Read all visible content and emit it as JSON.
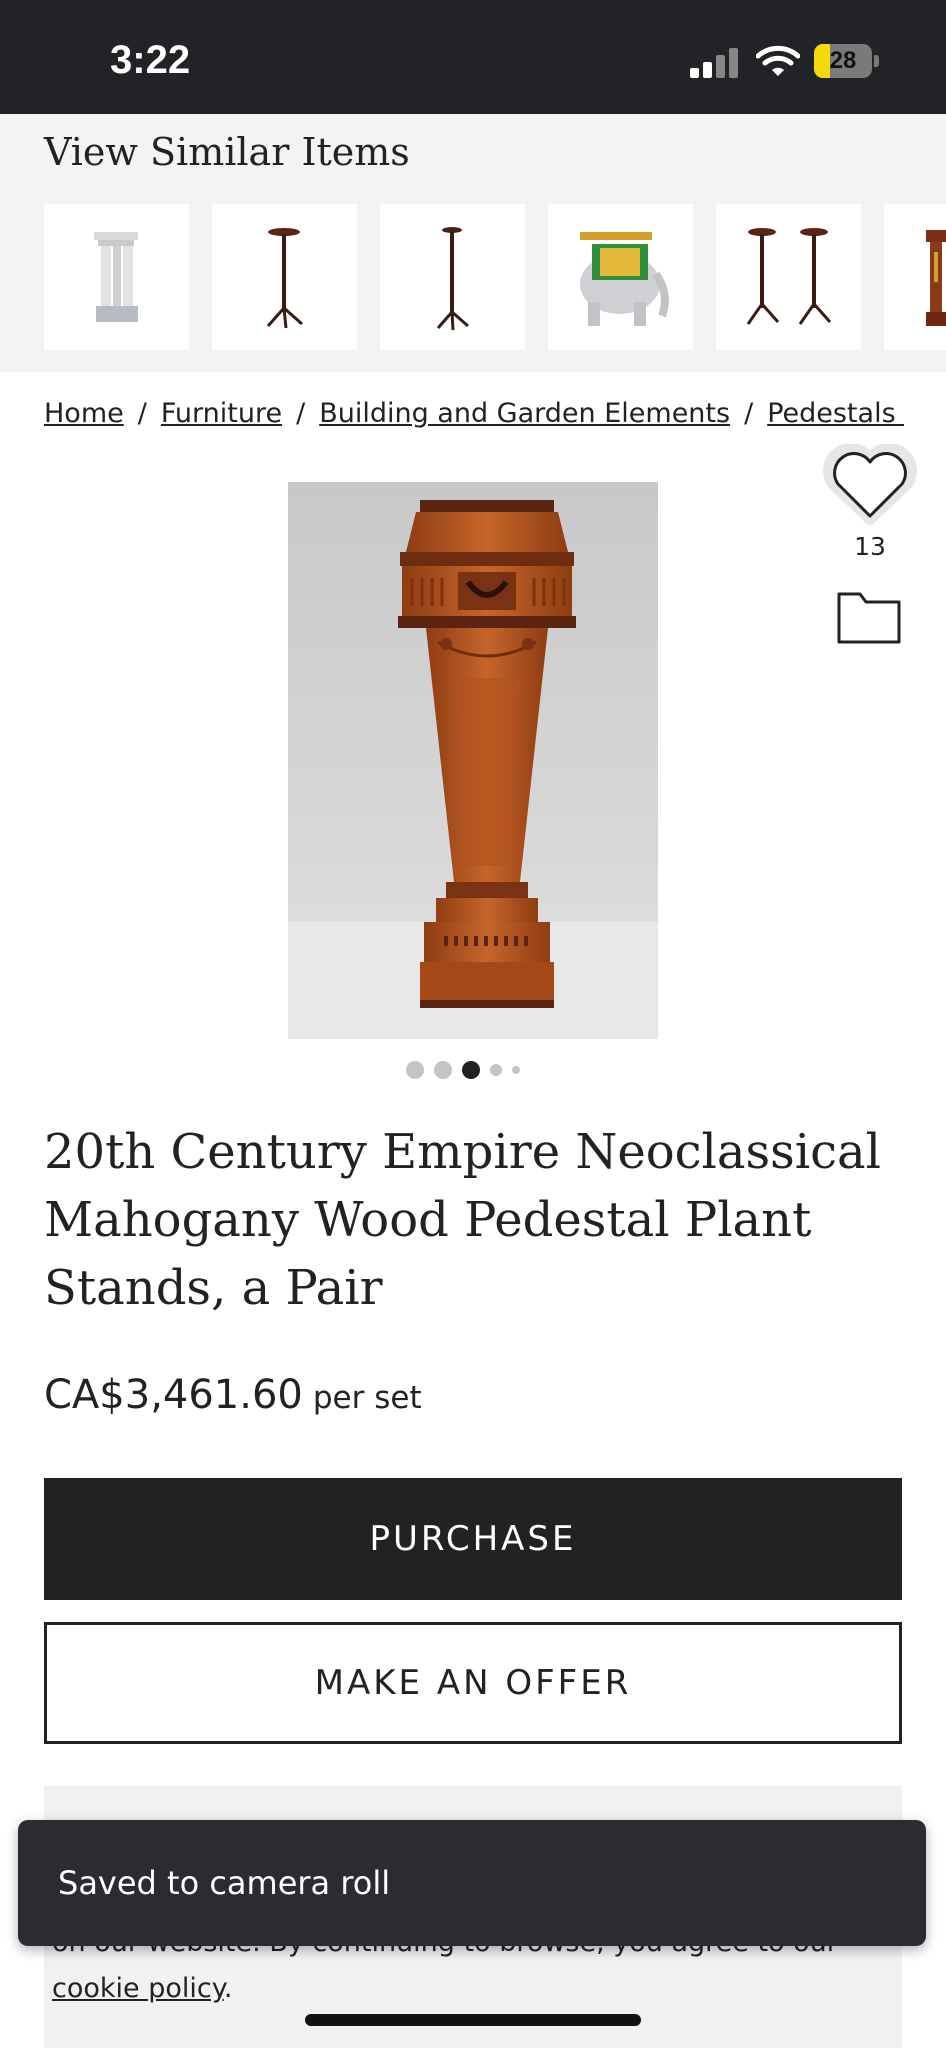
{
  "status_bar": {
    "time": "3:22",
    "battery_level": "28",
    "battery_fraction": 0.28,
    "battery_color": "#f5d90a"
  },
  "similar_items": {
    "title": "View Similar Items",
    "thumbnails": [
      {
        "name": "white-column-pedestal"
      },
      {
        "name": "tripod-candle-stand"
      },
      {
        "name": "tall-tripod-stand"
      },
      {
        "name": "elephant-garden-stool"
      },
      {
        "name": "pair-of-tripod-stands"
      },
      {
        "name": "wood-pedestal"
      }
    ]
  },
  "breadcrumb": {
    "items": [
      "Home",
      "Furniture",
      "Building and Garden Elements",
      "Pedestals and Columns"
    ],
    "separator": "/"
  },
  "favorite": {
    "count": "13",
    "icon": "heart-icon"
  },
  "folder": {
    "icon": "folder-icon"
  },
  "carousel": {
    "dot_count": 5,
    "active_index": 2
  },
  "product": {
    "title": "20th Century Empire Neoclassical Mahogany Wood Pedestal Plant Stands, a Pair",
    "price": "CA$3,461.60",
    "price_unit": "per set"
  },
  "actions": {
    "purchase_label": "PURCHASE",
    "offer_label": "MAKE AN OFFER"
  },
  "cookie_notice": {
    "text": "on our website. By continuing to browse, you agree to our",
    "link": "cookie policy",
    "suffix": "."
  },
  "toast": {
    "message": "Saved to camera roll"
  },
  "colors": {
    "dark": "#222222",
    "status_bg": "#222326",
    "toast_bg": "#2b2c31",
    "panel_bg": "#f3f3f3",
    "mahogany": "#b5541f"
  }
}
